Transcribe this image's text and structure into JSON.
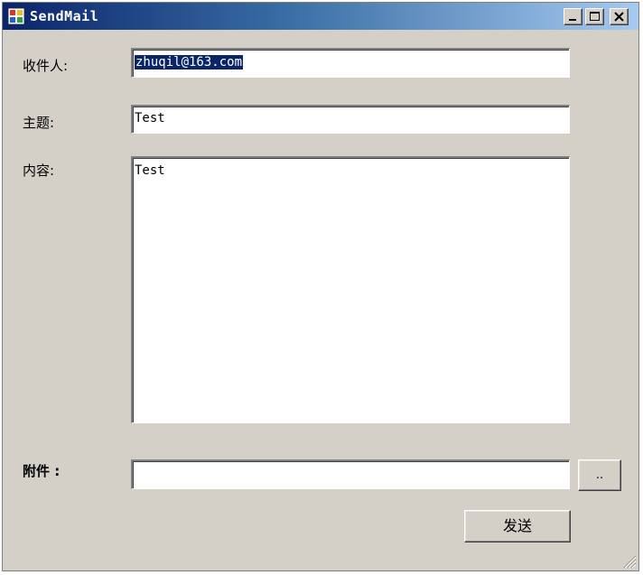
{
  "window": {
    "title": "SendMail",
    "minimize_symbol": "_",
    "maximize_symbol": "□",
    "close_symbol": "×"
  },
  "form": {
    "to_label": "收件人:",
    "to_value": "zhuqil@163.com",
    "subject_label": "主题:",
    "subject_value": "Test",
    "body_label": "内容:",
    "body_value": "Test",
    "attachment_label": "附件 :",
    "attachment_value": "",
    "browse_label": "..",
    "send_label": "发送"
  },
  "icons": {
    "app": "app-icon",
    "minimize": "minimize-icon",
    "maximize": "maximize-icon",
    "close": "close-icon",
    "resize": "resize-grip-icon"
  },
  "colors": {
    "titlebar_start": "#0a246a",
    "titlebar_end": "#a6caf0",
    "window_bg": "#d4d0c8",
    "selection_bg": "#0a246a"
  }
}
